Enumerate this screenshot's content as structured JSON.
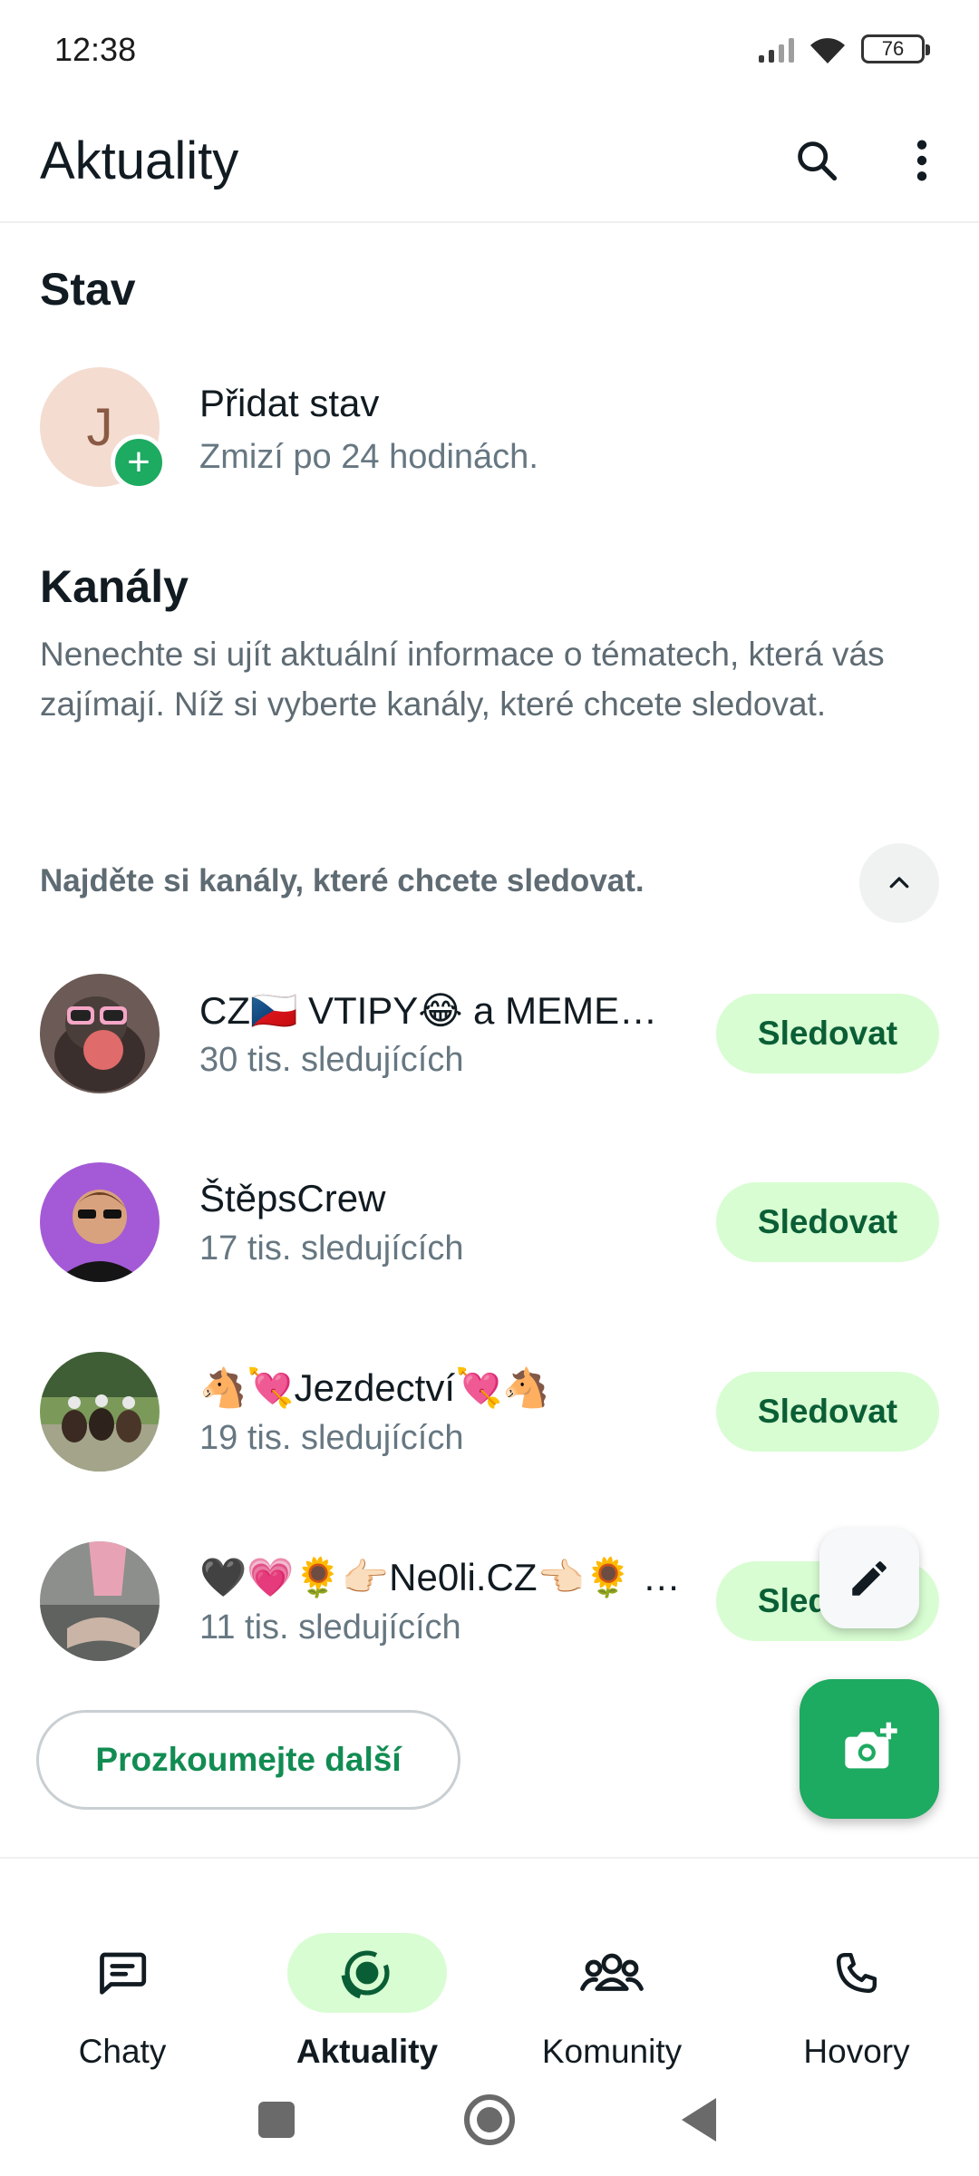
{
  "status_bar": {
    "time": "12:38",
    "battery": "76"
  },
  "app_bar": {
    "title": "Aktuality",
    "search_icon": "search-icon",
    "menu_icon": "more-vert-icon"
  },
  "status_section": {
    "heading": "Stav",
    "avatar_letter": "J",
    "add_title": "Přidat stav",
    "add_subtitle": "Zmizí po 24 hodinách."
  },
  "channels_section": {
    "heading": "Kanály",
    "description": "Nenechte si ujít aktuální informace o tématech, která vás zajímají. Níž si vyberte kanály, které chcete sledovat.",
    "find_label": "Najděte si kanály, které chcete sledovat.",
    "items": [
      {
        "name": "CZ🇨🇿 VTIPY😂 a MEME…",
        "followers": "30 tis. sledujících",
        "button": "Sledovat"
      },
      {
        "name": "ŠtěpsCrew",
        "followers": "17 tis. sledujících",
        "button": "Sledovat"
      },
      {
        "name": "🐴💘Jezdectví💘🐴",
        "followers": "19 tis. sledujících",
        "button": "Sledovat"
      },
      {
        "name": "🖤💗🌻👉🏻Ne0li.CZ👈🏻🌻 …",
        "followers": "11 tis. sledujících",
        "button": "Sledovat"
      }
    ],
    "explore_button": "Prozkoumejte další"
  },
  "fabs": {
    "pencil_icon": "pencil-icon",
    "camera_icon": "camera-plus-icon"
  },
  "bottom_nav": {
    "items": [
      {
        "label": "Chaty",
        "icon": "chat-icon"
      },
      {
        "label": "Aktuality",
        "icon": "updates-icon"
      },
      {
        "label": "Komunity",
        "icon": "communities-icon"
      },
      {
        "label": "Hovory",
        "icon": "phone-icon"
      }
    ],
    "active_index": 1
  },
  "colors": {
    "accent": "#1daa61",
    "accent_light": "#d8fdd2",
    "accent_text": "#0a5e36"
  }
}
